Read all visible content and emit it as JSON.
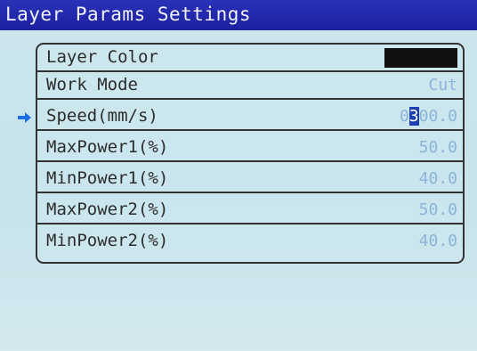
{
  "title": "Layer Params Settings",
  "colors": {
    "titlebar": "#1c20a0",
    "background": "#cde6ee",
    "value_text": "#8cb4d8",
    "layer_color": "#111111",
    "arrow": "#1e6fe0"
  },
  "icons": {
    "selection": "right-arrow-icon"
  },
  "rows": [
    {
      "label": "Layer Color",
      "value": ""
    },
    {
      "label": "Work Mode",
      "value": "Cut"
    },
    {
      "label": "Speed(mm/s)",
      "value_pre": "0",
      "value_cursor": "3",
      "value_post": "00.0"
    },
    {
      "label": "MaxPower1(%)",
      "value": "50.0"
    },
    {
      "label": "MinPower1(%)",
      "value": "40.0"
    },
    {
      "label": "MaxPower2(%)",
      "value": "50.0"
    },
    {
      "label": "MinPower2(%)",
      "value": "40.0"
    }
  ]
}
